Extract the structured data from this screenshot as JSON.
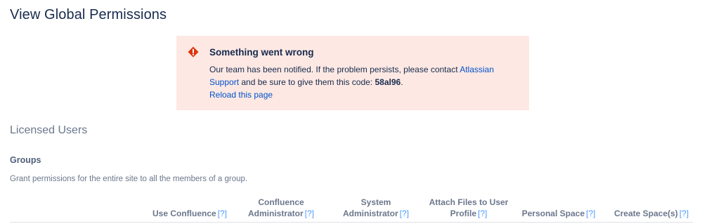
{
  "page": {
    "title": "View Global Permissions"
  },
  "error": {
    "title": "Something went wrong",
    "body_prefix": "Our team has been notified. If the problem persists, please contact ",
    "support_link": "Atlassian Support",
    "body_middle": " and be sure to give them this code: ",
    "code": "58al96",
    "body_suffix": ".",
    "reload_link": "Reload this page",
    "icon": "error-diamond-icon",
    "colors": {
      "background": "#fde8e3",
      "icon": "#de350b"
    }
  },
  "licensed_users": {
    "title": "Licensed Users"
  },
  "groups": {
    "title": "Groups",
    "description": "Grant permissions for the entire site to all the members of a group.",
    "help_marker": "[?]",
    "columns": [
      {
        "line1": "",
        "line2": "Use Confluence"
      },
      {
        "line1": "Confluence",
        "line2": "Administrator"
      },
      {
        "line1": "System",
        "line2": "Administrator"
      },
      {
        "line1": "Attach Files to User",
        "line2": "Profile"
      },
      {
        "line1": "",
        "line2": "Personal Space"
      },
      {
        "line1": "",
        "line2": "Create Space(s)"
      }
    ]
  }
}
